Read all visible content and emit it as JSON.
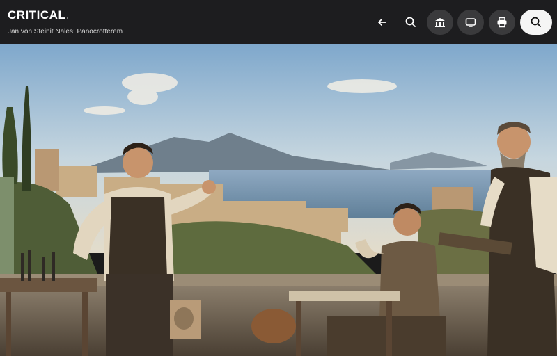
{
  "header": {
    "title": "CRITICAL",
    "subtitle": "Jan von Steinit Nales: Panocrotterem"
  },
  "toolbar": {
    "buttons": [
      {
        "icon": "arrow-left-icon"
      },
      {
        "icon": "search-icon"
      },
      {
        "icon": "museum-icon"
      },
      {
        "icon": "cast-icon"
      },
      {
        "icon": "print-icon"
      },
      {
        "icon": "search-icon"
      }
    ]
  },
  "colors": {
    "topbar": "#1d1d1f",
    "button_dark": "#3a3a3c",
    "button_light": "#f5f5f5"
  }
}
